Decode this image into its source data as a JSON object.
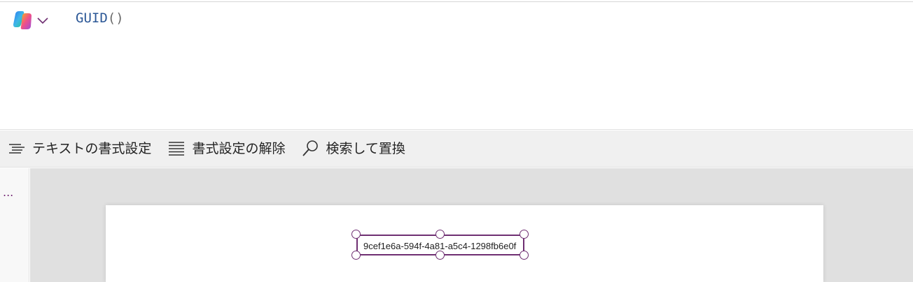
{
  "formula_bar": {
    "function_name": "GUID",
    "parens": "()"
  },
  "toolbar": {
    "format_text_label": "テキストの書式設定",
    "remove_format_label": "書式設定の解除",
    "find_replace_label": "検索して置換"
  },
  "left_pane": {
    "more_label": "..."
  },
  "canvas": {
    "label_value": "9cef1e6a-594f-4a81-a5c4-1298fb6e0f"
  },
  "colors": {
    "selection": "#6f2f72",
    "function_text": "#2b5796",
    "toolbar_bg": "#f0f0f0",
    "canvas_bg": "#e0e0e0"
  },
  "icons": {
    "copilot": "copilot-icon",
    "dropdown": "chevron-down-icon",
    "format_text": "format-text-icon",
    "remove_format": "lines-icon",
    "search": "search-icon"
  }
}
